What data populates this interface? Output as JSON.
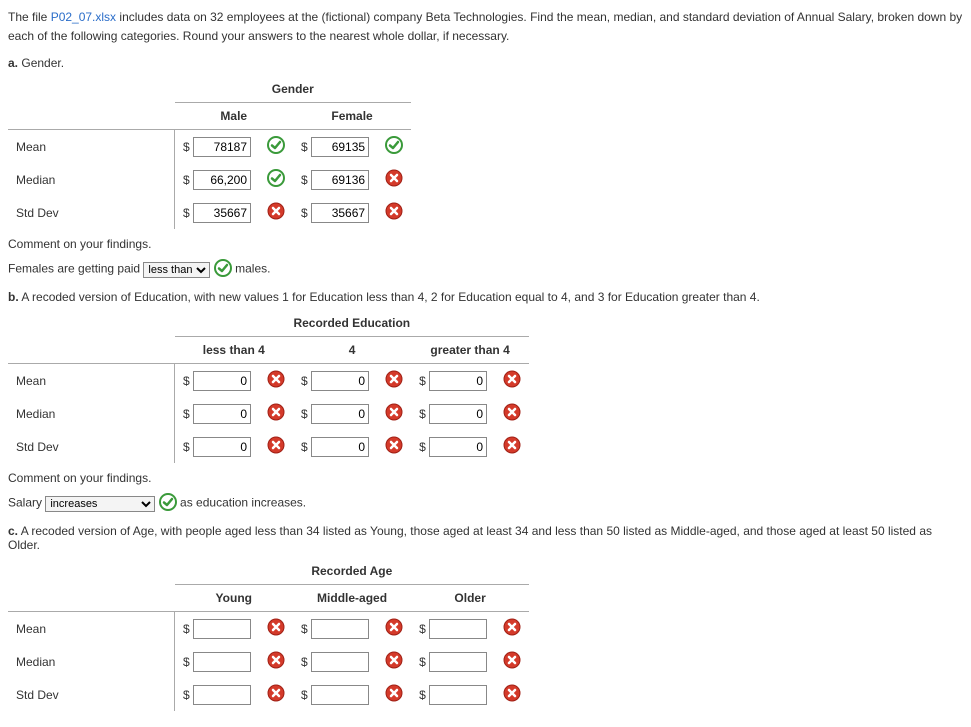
{
  "intro": {
    "prefix": "The file ",
    "file": "P02_07.xlsx",
    "mid": " includes data on 32 employees at the (fictional) company Beta Technologies. Find the mean, median, and standard deviation of Annual Salary, broken down by each of the following categories. Round your answers to the nearest whole dollar, if necessary."
  },
  "dollar": "$",
  "rows": {
    "mean": "Mean",
    "median": "Median",
    "stddev": "Std Dev"
  },
  "comment_label": "Comment on your findings.",
  "partA": {
    "label": "a.",
    "title": "Gender.",
    "superhead": "Gender",
    "cols": {
      "c1": "Male",
      "c2": "Female"
    },
    "vals": {
      "mean": {
        "c1": "78187",
        "c1_ok": true,
        "c2": "69135",
        "c2_ok": true
      },
      "median": {
        "c1": "66,200",
        "c1_ok": true,
        "c2": "69136",
        "c2_ok": false
      },
      "stddev": {
        "c1": "35667",
        "c1_ok": false,
        "c2": "35667",
        "c2_ok": false
      }
    },
    "sentence": {
      "pre": "Females are getting paid ",
      "sel": "less than",
      "sel_ok": true,
      "post": " males."
    }
  },
  "partB": {
    "label": "b.",
    "title": "A recoded version of Education, with new values 1 for Education less than 4, 2 for Education equal to 4, and 3 for Education greater than 4.",
    "superhead": "Recorded Education",
    "cols": {
      "c1": "less than 4",
      "c2": "4",
      "c3": "greater than 4"
    },
    "vals": {
      "mean": {
        "c1": "0",
        "c1_ok": false,
        "c2": "0",
        "c2_ok": false,
        "c3": "0",
        "c3_ok": false
      },
      "median": {
        "c1": "0",
        "c1_ok": false,
        "c2": "0",
        "c2_ok": false,
        "c3": "0",
        "c3_ok": false
      },
      "stddev": {
        "c1": "0",
        "c1_ok": false,
        "c2": "0",
        "c2_ok": false,
        "c3": "0",
        "c3_ok": false
      }
    },
    "sentence": {
      "pre": "Salary ",
      "sel": "increases",
      "sel_ok": true,
      "post": " as education increases."
    }
  },
  "partC": {
    "label": "c.",
    "title": "A recoded version of Age, with people aged less than 34 listed as Young, those aged at least 34 and less than 50 listed as Middle-aged, and those aged at least 50 listed as Older.",
    "superhead": "Recorded Age",
    "cols": {
      "c1": "Young",
      "c2": "Middle-aged",
      "c3": "Older"
    },
    "vals": {
      "mean": {
        "c1": "",
        "c1_ok": false,
        "c2": "",
        "c2_ok": false,
        "c3": "",
        "c3_ok": false
      },
      "median": {
        "c1": "",
        "c1_ok": false,
        "c2": "",
        "c2_ok": false,
        "c3": "",
        "c3_ok": false
      },
      "stddev": {
        "c1": "",
        "c1_ok": false,
        "c2": "",
        "c2_ok": false,
        "c3": "",
        "c3_ok": false
      }
    }
  }
}
